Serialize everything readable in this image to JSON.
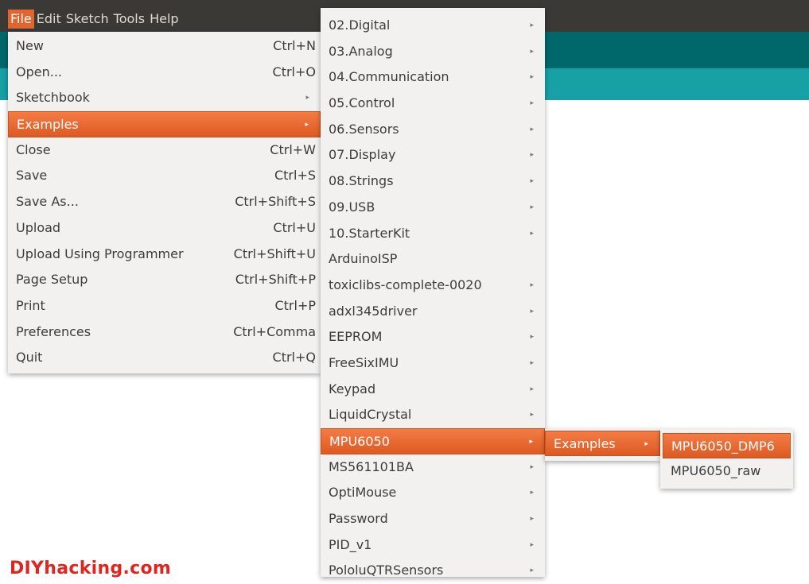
{
  "colors": {
    "menubar_bg": "#3a3936",
    "teal_dark": "#00676b",
    "teal_light": "#17a1a5",
    "highlight": "#e2652f",
    "menu_bg": "#f2f1f0",
    "watermark": "#e0251f"
  },
  "menubar": {
    "items": [
      {
        "label": "File"
      },
      {
        "label": "Edit"
      },
      {
        "label": "Sketch"
      },
      {
        "label": "Tools"
      },
      {
        "label": "Help"
      }
    ]
  },
  "file_menu": {
    "items": [
      {
        "label": "New",
        "shortcut": "Ctrl+N"
      },
      {
        "label": "Open...",
        "shortcut": "Ctrl+O"
      },
      {
        "label": "Sketchbook",
        "shortcut": ""
      },
      {
        "label": "Examples",
        "shortcut": ""
      },
      {
        "label": "Close",
        "shortcut": "Ctrl+W"
      },
      {
        "label": "Save",
        "shortcut": "Ctrl+S"
      },
      {
        "label": "Save As...",
        "shortcut": "Ctrl+Shift+S"
      },
      {
        "label": "Upload",
        "shortcut": "Ctrl+U"
      },
      {
        "label": "Upload Using Programmer",
        "shortcut": "Ctrl+Shift+U"
      },
      {
        "label": "Page Setup",
        "shortcut": "Ctrl+Shift+P"
      },
      {
        "label": "Print",
        "shortcut": "Ctrl+P"
      },
      {
        "label": "Preferences",
        "shortcut": "Ctrl+Comma"
      },
      {
        "label": "Quit",
        "shortcut": "Ctrl+Q"
      }
    ],
    "submenu_arrow": "▸"
  },
  "examples_menu": {
    "items": [
      {
        "label": "02.Digital"
      },
      {
        "label": "03.Analog"
      },
      {
        "label": "04.Communication"
      },
      {
        "label": "05.Control"
      },
      {
        "label": "06.Sensors"
      },
      {
        "label": "07.Display"
      },
      {
        "label": "08.Strings"
      },
      {
        "label": "09.USB"
      },
      {
        "label": "10.StarterKit"
      },
      {
        "label": "ArduinoISP"
      },
      {
        "label": "toxiclibs-complete-0020"
      },
      {
        "label": "adxl345driver"
      },
      {
        "label": "EEPROM"
      },
      {
        "label": "FreeSixIMU"
      },
      {
        "label": "Keypad"
      },
      {
        "label": "LiquidCrystal"
      },
      {
        "label": "MPU6050"
      },
      {
        "label": "MS561101BA"
      },
      {
        "label": "OptiMouse"
      },
      {
        "label": "Password"
      },
      {
        "label": "PID_v1"
      },
      {
        "label": "PololuQTRSensors"
      }
    ]
  },
  "mpu_menu": {
    "items": [
      {
        "label": "Examples"
      }
    ]
  },
  "mpu_examples_menu": {
    "items": [
      {
        "label": "MPU6050_DMP6"
      },
      {
        "label": "MPU6050_raw"
      }
    ]
  },
  "watermark": "DIYhacking.com"
}
